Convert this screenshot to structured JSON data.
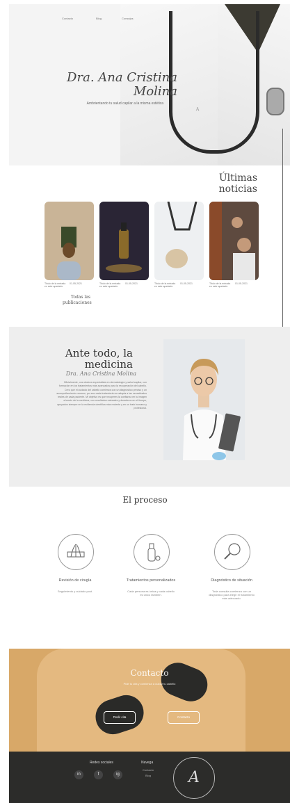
{
  "nav": {
    "items": [
      "Consejos",
      "Blog",
      "Contacto"
    ]
  },
  "hero": {
    "title": "Dra. Ana Cristina Molina",
    "subtitle": "Ambrientando tu salud capilar a la misma estética",
    "logo_text": "A"
  },
  "news": {
    "title": "Últimas noticias",
    "cards": [
      {
        "caption": "Título de la entrada en este apartado",
        "date": "01-05-2021",
        "colors": [
          "#c9b497",
          "#8f7a60"
        ]
      },
      {
        "caption": "Título de la entrada en este apartado",
        "date": "01-05-2021",
        "colors": [
          "#2a2535",
          "#6b4e2a"
        ]
      },
      {
        "caption": "Título de la entrada en este apartado",
        "date": "01-05-2021",
        "colors": [
          "#eef0f2",
          "#d0d4d8"
        ]
      },
      {
        "caption": "Título de la entrada en este apartado",
        "date": "01-05-2021",
        "colors": [
          "#5e4a3f",
          "#c2a98b"
        ]
      }
    ],
    "all_label": "Todas las publicaciones"
  },
  "about": {
    "title": "Ante todo, la medicina",
    "name": "Dra. Ana Cristina Molina",
    "text": "Oficialmente, una doctora especialista en dermatología y salud capilar, con formación en los tratamientos más avanzados para la recuperación del cabello. Creo que el cuidado del cabello comienza con un diagnóstico preciso y un acompañamiento cercano, por eso cada tratamiento se adapta a las necesidades reales de cada paciente. Mi objetivo es que recuperes la confianza en tu imagen a través de la medicina, con resultados naturales y duraderos en el tiempo, apoyados siempre en la evidencia científica más reciente y en un trato humano y profesional."
  },
  "process": {
    "title": "El proceso",
    "steps": [
      {
        "title": "Diagnóstico de situación",
        "text": "Toda consulta comienza con un diagnóstico para elegir el tratamiento más adecuado.",
        "icon": "magnifier-icon"
      },
      {
        "title": "Tratamientos personalizados",
        "text": "Cada persona es única y cada cabello es único también.",
        "icon": "serum-bottle-icon"
      },
      {
        "title": "Revisión de cirugía",
        "text": "Seguimiento y cuidado post.",
        "icon": "hair-follicle-icon"
      }
    ]
  },
  "contact": {
    "title": "Contacto",
    "subtitle": "Pide tu cita y comienza a cuidar tu cabello",
    "buttons": [
      "Pedir cita",
      "Contacto"
    ]
  },
  "footer": {
    "logo": "A",
    "col1_title": "Navega",
    "col1_links": [
      "Contacto",
      "Blog"
    ],
    "col2_title": "Redes sociales",
    "socials": [
      "ig",
      "f",
      "in"
    ]
  }
}
